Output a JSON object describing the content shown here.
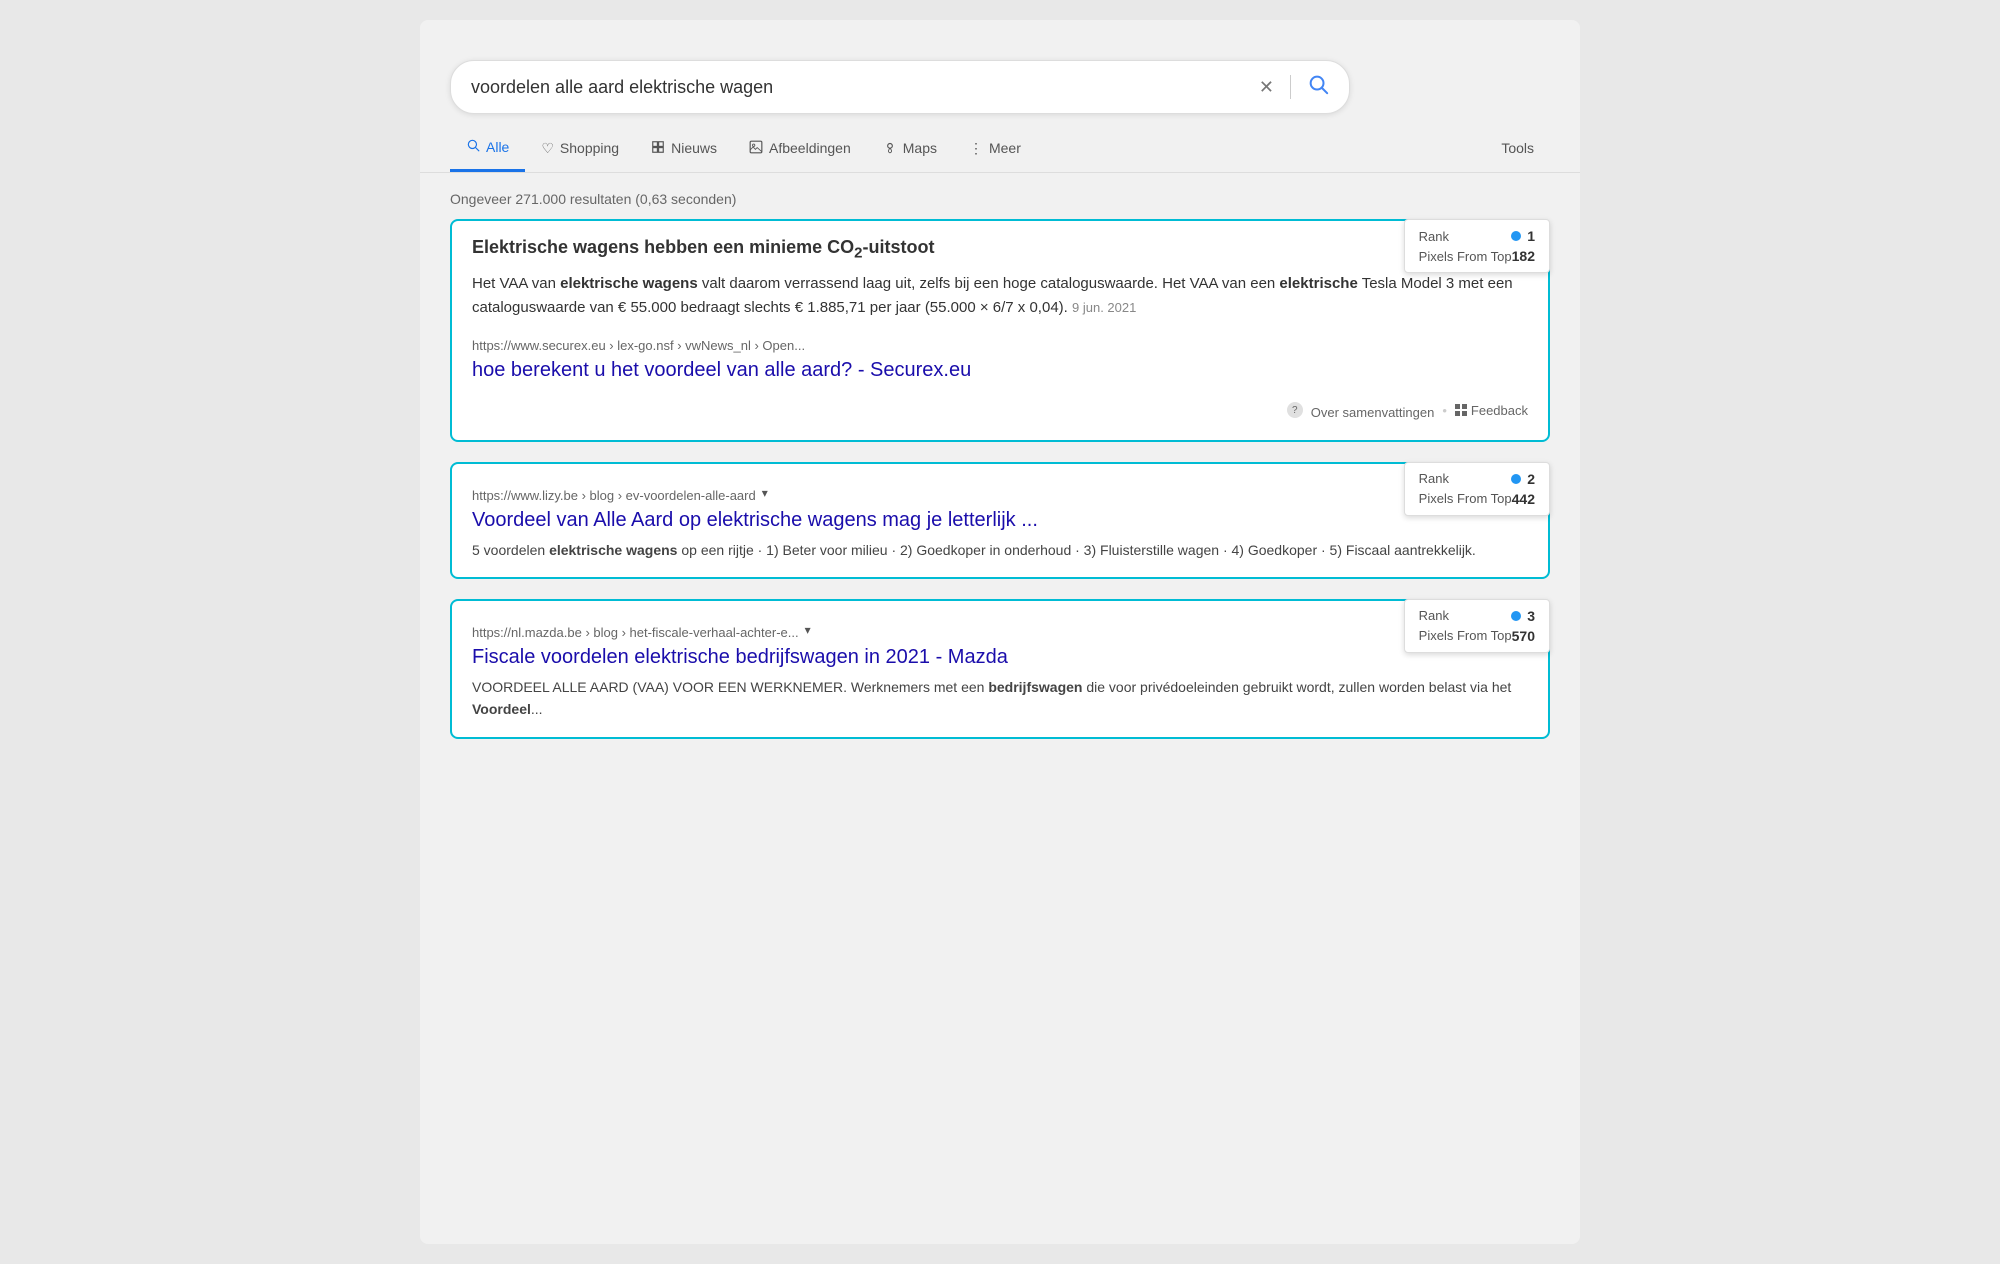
{
  "search": {
    "query": "voordelen alle aard elektrische wagen",
    "placeholder": "Search"
  },
  "tabs": [
    {
      "label": "Alle",
      "icon": "🔍",
      "active": true
    },
    {
      "label": "Shopping",
      "icon": "♡"
    },
    {
      "label": "Nieuws",
      "icon": "▦"
    },
    {
      "label": "Afbeeldingen",
      "icon": "⊞"
    },
    {
      "label": "Maps",
      "icon": "◎"
    },
    {
      "label": "Meer",
      "icon": "⋮"
    }
  ],
  "tools_label": "Tools",
  "results_count": "Ongeveer 271.000 resultaten (0,63 seconden)",
  "results": [
    {
      "rank": "1",
      "pixels_from_top": "182",
      "heading": "Elektrische wagens hebben een minieme CO₂-uitstoot",
      "snippet": "Het VAA van elektrische wagens valt daarom verrassend laag uit, zelfs bij een hoge cataloguswaarde. Het VAA van een elektrische Tesla Model 3 met een cataloguswaarde van € 55.000 bedraagt slechts € 1.885,71 per jaar (55.000 × 6/7 x 0,04).",
      "date": "9 jun. 2021",
      "url": "https://www.securex.eu › lex-go.nsf › vwNews_nl › Open...",
      "title": "hoe berekent u het voordeel van alle aard? - Securex.eu",
      "feedback_label": "Over samenvattingen",
      "feedback_action": "Feedback"
    },
    {
      "rank": "2",
      "pixels_from_top": "442",
      "url": "https://www.lizy.be › blog › ev-voordelen-alle-aard",
      "title": "Voordeel van Alle Aard op elektrische wagens mag je letterlijk ...",
      "description": "5 voordelen elektrische wagens op een rijtje · 1) Beter voor milieu · 2) Goedkoper in onderhoud · 3) Fluisterstille wagen · 4) Goedkoper · 5) Fiscaal aantrekkelijk."
    },
    {
      "rank": "3",
      "pixels_from_top": "570",
      "url": "https://nl.mazda.be › blog › het-fiscale-verhaal-achter-e...",
      "title": "Fiscale voordelen elektrische bedrijfswagen in 2021 - Mazda",
      "description": "VOORDEEL ALLE AARD (VAA) VOOR EEN WERKNEMER. Werknemers met een bedrijfswagen die voor privédoeleinden gebruikt wordt, zullen worden belast via het Voordeel..."
    }
  ]
}
